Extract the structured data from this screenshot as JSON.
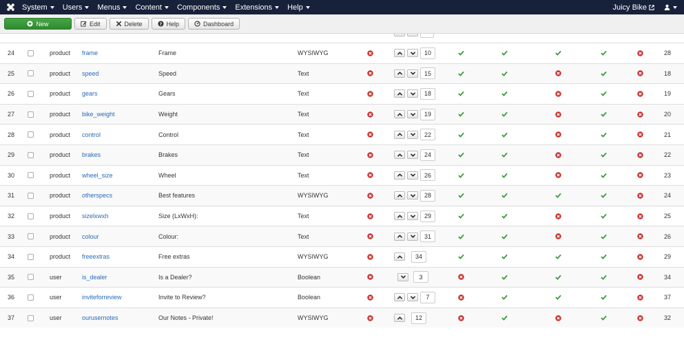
{
  "navbar": {
    "menus": [
      "System",
      "Users",
      "Menus",
      "Content",
      "Components",
      "Extensions",
      "Help"
    ],
    "site_name": "Juicy Bike",
    "colors": {
      "bg": "#17213a"
    }
  },
  "toolbar": {
    "new_label": "New",
    "edit_label": "Edit",
    "delete_label": "Delete",
    "help_label": "Help",
    "dashboard_label": "Dashboard"
  },
  "colors": {
    "green": "#3c9b3c",
    "red": "#c9302c",
    "link": "#2a69b8"
  },
  "rows": [
    {
      "id": "24",
      "category": "product",
      "name": "frame",
      "label": "Frame",
      "type": "WYSIWYG",
      "required": false,
      "up": true,
      "down": true,
      "order": "10",
      "s1": true,
      "s2": true,
      "s3": true,
      "s4": true,
      "s5": false,
      "num": "28"
    },
    {
      "id": "25",
      "category": "product",
      "name": "speed",
      "label": "Speed",
      "type": "Text",
      "required": false,
      "up": true,
      "down": true,
      "order": "15",
      "s1": true,
      "s2": true,
      "s3": false,
      "s4": true,
      "s5": false,
      "num": "18"
    },
    {
      "id": "26",
      "category": "product",
      "name": "gears",
      "label": "Gears",
      "type": "Text",
      "required": false,
      "up": true,
      "down": true,
      "order": "18",
      "s1": true,
      "s2": true,
      "s3": false,
      "s4": true,
      "s5": false,
      "num": "19"
    },
    {
      "id": "27",
      "category": "product",
      "name": "bike_weight",
      "label": "Weight",
      "type": "Text",
      "required": false,
      "up": true,
      "down": true,
      "order": "19",
      "s1": true,
      "s2": true,
      "s3": false,
      "s4": true,
      "s5": false,
      "num": "20"
    },
    {
      "id": "28",
      "category": "product",
      "name": "control",
      "label": "Control",
      "type": "Text",
      "required": false,
      "up": true,
      "down": true,
      "order": "22",
      "s1": true,
      "s2": true,
      "s3": false,
      "s4": true,
      "s5": false,
      "num": "21"
    },
    {
      "id": "29",
      "category": "product",
      "name": "brakes",
      "label": "Brakes",
      "type": "Text",
      "required": false,
      "up": true,
      "down": true,
      "order": "24",
      "s1": true,
      "s2": true,
      "s3": false,
      "s4": true,
      "s5": false,
      "num": "22"
    },
    {
      "id": "30",
      "category": "product",
      "name": "wheel_size",
      "label": "Wheel",
      "type": "Text",
      "required": false,
      "up": true,
      "down": true,
      "order": "26",
      "s1": true,
      "s2": true,
      "s3": false,
      "s4": true,
      "s5": false,
      "num": "23"
    },
    {
      "id": "31",
      "category": "product",
      "name": "otherspecs",
      "label": "Best features",
      "type": "WYSIWYG",
      "required": false,
      "up": true,
      "down": true,
      "order": "28",
      "s1": true,
      "s2": true,
      "s3": true,
      "s4": true,
      "s5": false,
      "num": "24"
    },
    {
      "id": "32",
      "category": "product",
      "name": "sizelxwxh",
      "label": "Size (LxWxH):",
      "type": "Text",
      "required": false,
      "up": true,
      "down": true,
      "order": "29",
      "s1": true,
      "s2": true,
      "s3": false,
      "s4": true,
      "s5": false,
      "num": "25"
    },
    {
      "id": "33",
      "category": "product",
      "name": "colour",
      "label": "Colour:",
      "type": "Text",
      "required": false,
      "up": true,
      "down": true,
      "order": "31",
      "s1": true,
      "s2": true,
      "s3": false,
      "s4": true,
      "s5": false,
      "num": "26"
    },
    {
      "id": "34",
      "category": "product",
      "name": "freeextras",
      "label": "Free extras",
      "type": "WYSIWYG",
      "required": false,
      "up": true,
      "down": false,
      "order": "34",
      "s1": true,
      "s2": true,
      "s3": true,
      "s4": true,
      "s5": false,
      "num": "29"
    },
    {
      "id": "35",
      "category": "user",
      "name": "is_dealer",
      "label": "Is a Dealer?",
      "type": "Boolean",
      "required": false,
      "up": false,
      "down": true,
      "order": "3",
      "s1": false,
      "s2": true,
      "s3": true,
      "s4": true,
      "s5": false,
      "num": "34"
    },
    {
      "id": "36",
      "category": "user",
      "name": "inviteforreview",
      "label": "Invite to Review?",
      "type": "Boolean",
      "required": false,
      "up": true,
      "down": true,
      "order": "7",
      "s1": false,
      "s2": true,
      "s3": true,
      "s4": true,
      "s5": false,
      "num": "37"
    },
    {
      "id": "37",
      "category": "user",
      "name": "ourusernotes",
      "label": "Our Notes - Private!",
      "type": "WYSIWYG",
      "required": false,
      "up": true,
      "down": false,
      "order": "12",
      "s1": false,
      "s2": true,
      "s3": false,
      "s4": true,
      "s5": false,
      "num": "32"
    }
  ]
}
